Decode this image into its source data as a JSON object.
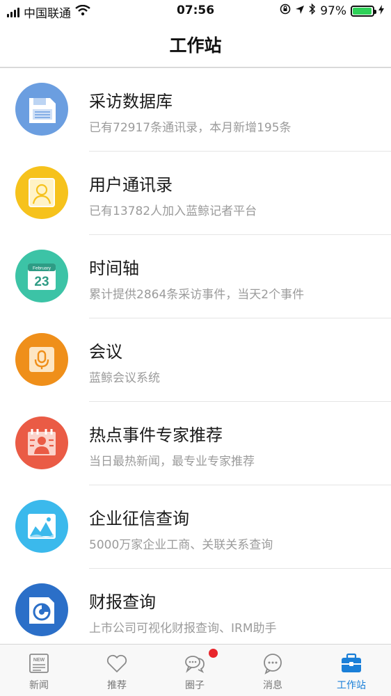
{
  "status_bar": {
    "carrier": "中国联通",
    "time": "07:56",
    "battery_percent": "97%",
    "battery_level": 0.97,
    "icons": [
      "signal-icon",
      "wifi-icon",
      "orientation-lock-icon",
      "location-icon",
      "bluetooth-icon",
      "battery-icon",
      "charging-icon"
    ]
  },
  "header": {
    "title": "工作站"
  },
  "items": [
    {
      "title": "采访数据库",
      "subtitle": "已有72917条通讯录，本月新增195条",
      "icon": "database-icon",
      "color": "#6b9ee0"
    },
    {
      "title": "用户通讯录",
      "subtitle": "已有13782人加入蓝鲸记者平台",
      "icon": "contacts-icon",
      "color": "#f6c21c"
    },
    {
      "title": "时间轴",
      "subtitle": "累计提供2864条采访事件，当天2个事件",
      "icon": "calendar-icon",
      "color": "#3cc3a6",
      "icon_text_month": "February",
      "icon_text_day": "23"
    },
    {
      "title": "会议",
      "subtitle": "蓝鲸会议系统",
      "icon": "microphone-icon",
      "color": "#ef8f1a"
    },
    {
      "title": "热点事件专家推荐",
      "subtitle": "当日最热新闻，最专业专家推荐",
      "icon": "expert-icon",
      "color": "#ea5b45"
    },
    {
      "title": "企业征信查询",
      "subtitle": "5000万家企业工商、关联关系查询",
      "icon": "enterprise-icon",
      "color": "#3bb9ec"
    },
    {
      "title": "财报查询",
      "subtitle": "上市公司可视化财报查询、IRM助手",
      "icon": "financial-report-icon",
      "color": "#2b6fc8"
    }
  ],
  "tab_bar": {
    "tabs": [
      {
        "label": "新闻",
        "icon": "news-icon",
        "icon_text": "NEW"
      },
      {
        "label": "推荐",
        "icon": "heart-icon"
      },
      {
        "label": "圈子",
        "icon": "chat-bubbles-icon",
        "badge": true
      },
      {
        "label": "消息",
        "icon": "message-icon"
      },
      {
        "label": "工作站",
        "icon": "briefcase-icon",
        "active": true
      }
    ],
    "active_color": "#1a7fd8",
    "badge_color": "#e8262c"
  }
}
